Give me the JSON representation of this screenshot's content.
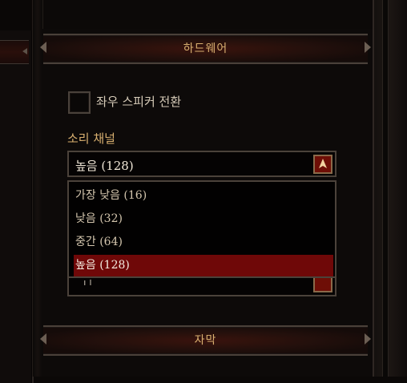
{
  "sections": {
    "hardware": {
      "title": "하드웨어"
    },
    "subtitles": {
      "title": "자막"
    }
  },
  "speaker_swap": {
    "label": "좌우 스피커 전환",
    "checked": false
  },
  "sound_channel": {
    "label": "소리 채널",
    "selected": "높음 (128)",
    "options": [
      "가장 낮음 (16)",
      "낮음 (32)",
      "중간 (64)",
      "높음 (128)"
    ],
    "selected_index": 3,
    "hidden_select_fragment": "니"
  },
  "colors": {
    "accent": "#d9b070",
    "selection": "#6f0808",
    "button": "#6e0e06"
  }
}
